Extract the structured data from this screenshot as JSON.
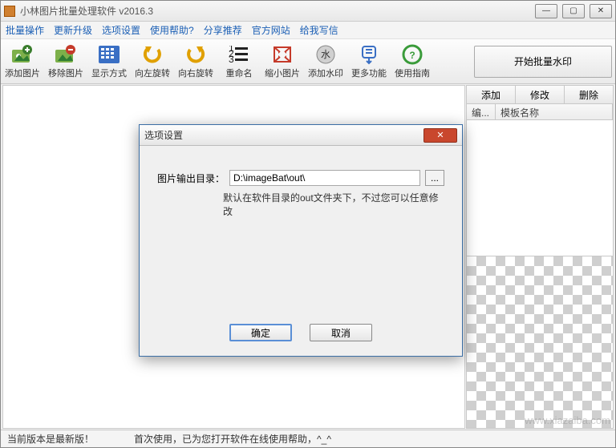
{
  "title": "小林图片批量处理软件  v2016.3",
  "menu": [
    "批量操作",
    "更新升级",
    "选项设置",
    "使用帮助?",
    "分享推荐",
    "官方网站",
    "给我写信"
  ],
  "tools": [
    {
      "label": "添加图片",
      "icon": "add"
    },
    {
      "label": "移除图片",
      "icon": "remove"
    },
    {
      "label": "显示方式",
      "icon": "grid"
    },
    {
      "label": "向左旋转",
      "icon": "rotl"
    },
    {
      "label": "向右旋转",
      "icon": "rotr"
    },
    {
      "label": "重命名",
      "icon": "list"
    },
    {
      "label": "缩小图片",
      "icon": "shrink"
    },
    {
      "label": "添加水印",
      "icon": "water"
    },
    {
      "label": "更多功能",
      "icon": "more"
    },
    {
      "label": "使用指南",
      "icon": "help"
    }
  ],
  "bigbtn": "开始批量水印",
  "rightbtns": [
    "添加",
    "修改",
    "删除"
  ],
  "listcols": [
    "编...",
    "模板名称"
  ],
  "status": {
    "left": "当前版本是最新版！",
    "right": "首次使用，已为您打开软件在线使用帮助，^_^"
  },
  "dialog": {
    "title": "选项设置",
    "label": "图片输出目录：",
    "value": "D:\\imageBat\\out\\",
    "browse": "...",
    "note": "默认在软件目录的out文件夹下，不过您可以任意修改",
    "ok": "确定",
    "cancel": "取消"
  },
  "watermark": "www.xiazaiba.com"
}
